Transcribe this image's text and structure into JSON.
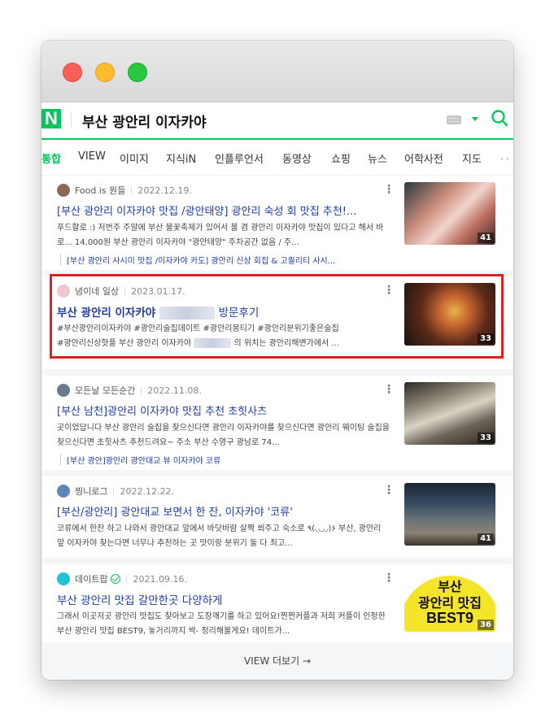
{
  "search": {
    "query": "부산 광안리 이자카야",
    "logo": "N"
  },
  "tabs": [
    "통합",
    "VIEW",
    "이미지",
    "지식iN",
    "인플루언서",
    "동영상",
    "쇼핑",
    "뉴스",
    "어학사전",
    "지도"
  ],
  "tab_active": "통합",
  "results": [
    {
      "author": "Food is 뭔들",
      "date": "2022.12.19.",
      "title": "[부산 광안리 이자카야 맛집 /광안태양] 광안리 숙성 회 맛집 추천!...",
      "desc": "푸드할로 :) 저번주 주말에 부산 불꽃축제가 있어서 볼 겸 광안리 이자카야 맛집이 있다고 해서 바로... 14,000원 부산 광안리 이자카야 \"광안태양\" 주차공간 없음 / 주...",
      "sub": "[부산 광안리 사시미 맛집 /이자카야 카도] 광안리 신상 회집 & 고퀄리티 사시...",
      "thumb_count": "41"
    },
    {
      "author": "녕이네 일상",
      "date": "2023.01.17.",
      "title_pre": "부산 광안리 이자카야",
      "title_post": "방문후기",
      "desc_line1": "#부산광안리이자카야 #광안리술집데이트 #광안리몽티기 #광안리분위기좋은술집",
      "desc_line2_pre": "#광안리신상핫플 부산 광안리 이자카야",
      "desc_line2_post": "의 위치는 광안리해변가에서 ...",
      "thumb_count": "33"
    },
    {
      "author": "모든날 모든순간",
      "date": "2022.11.08.",
      "title": "[부산 남천]광안리 이자카야 맛집 추천 초힛사츠",
      "desc": "곳이었답니다 부산 광안리 술집을 찾으신다면 광안리 이자카야를 찾으신다면 광안리 웨이팅 술집을 찾으신다면 초힛사츠 추천드려요~ 주소 부산 수영구 광남로 74...",
      "sub": "[부산 광안]광안리 광안대교 뷰 이자카야 코류",
      "thumb_count": "33"
    },
    {
      "author": "찡니로그",
      "date": "2022.12.22.",
      "title": "[부산/광안리] 광안대교 보면서 한 잔, 이자카야 '코류'",
      "desc": "코류에서 한잔 하고 나와서 광안대교 앞에서 바닷바람 살짝 쐬주고 숙소로 ٩(◟◡◞)۶ 부산, 광안리 앞 이자카야 찾는다면 너무나 추천하는 곳 맛이랑 분위기 둘 다 최고...",
      "thumb_count": "41"
    },
    {
      "author": "데이트팝",
      "date": "2021.09.16.",
      "title": "부산 광안리 맛집 갈만한곳 다양하게",
      "desc": "그래서 이곳저곳 광안리 맛집도 찾아보고 도장깨기를 하고 있어요!찐찐커플과 저희 커플이 인정한 부산 광안리 맛집 BEST9, 놓거리까지 싹- 정리해볼게요! 데이트가...",
      "thumb_line1": "부산",
      "thumb_line2": "광안리 맛집",
      "thumb_line3": "BEST9",
      "thumb_count": "36"
    }
  ],
  "more_button": "VIEW 더보기 →",
  "colors": {
    "accent": "#03c75a",
    "link": "#1f3ca8",
    "highlight_border": "#e3201f"
  }
}
